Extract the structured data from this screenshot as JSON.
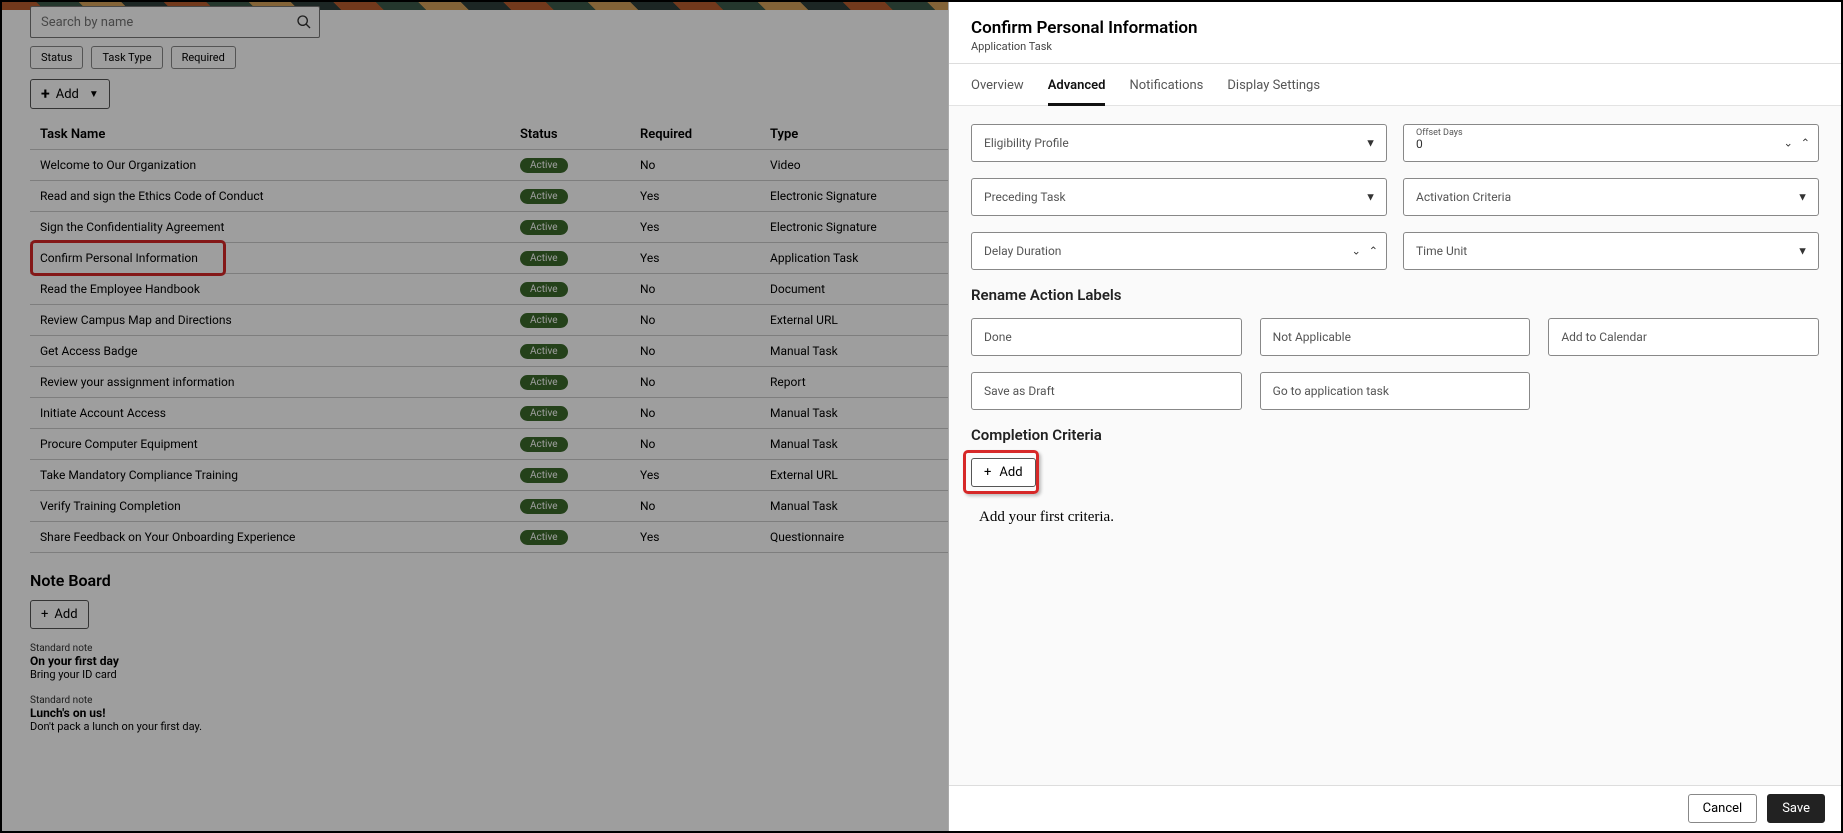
{
  "search": {
    "placeholder": "Search by name"
  },
  "filters": {
    "status": "Status",
    "taskType": "Task Type",
    "required": "Required"
  },
  "toolbar": {
    "add": "Add"
  },
  "table": {
    "headers": {
      "name": "Task Name",
      "status": "Status",
      "required": "Required",
      "type": "Type"
    },
    "rows": [
      {
        "name": "Welcome to Our Organization",
        "status": "Active",
        "required": "No",
        "type": "Video"
      },
      {
        "name": "Read and sign the Ethics Code of Conduct",
        "status": "Active",
        "required": "Yes",
        "type": "Electronic Signature"
      },
      {
        "name": "Sign the Confidentiality Agreement",
        "status": "Active",
        "required": "Yes",
        "type": "Electronic Signature"
      },
      {
        "name": "Confirm Personal Information",
        "status": "Active",
        "required": "Yes",
        "type": "Application Task"
      },
      {
        "name": "Read the Employee Handbook",
        "status": "Active",
        "required": "No",
        "type": "Document"
      },
      {
        "name": "Review Campus Map and Directions",
        "status": "Active",
        "required": "No",
        "type": "External URL"
      },
      {
        "name": "Get Access Badge",
        "status": "Active",
        "required": "No",
        "type": "Manual Task"
      },
      {
        "name": "Review your assignment information",
        "status": "Active",
        "required": "No",
        "type": "Report"
      },
      {
        "name": "Initiate Account Access",
        "status": "Active",
        "required": "No",
        "type": "Manual Task"
      },
      {
        "name": "Procure Computer Equipment",
        "status": "Active",
        "required": "No",
        "type": "Manual Task"
      },
      {
        "name": "Take Mandatory Compliance Training",
        "status": "Active",
        "required": "Yes",
        "type": "External URL"
      },
      {
        "name": "Verify Training Completion",
        "status": "Active",
        "required": "No",
        "type": "Manual Task"
      },
      {
        "name": "Share Feedback on Your Onboarding Experience",
        "status": "Active",
        "required": "Yes",
        "type": "Questionnaire"
      }
    ]
  },
  "noteBoard": {
    "heading": "Note Board",
    "add": "Add",
    "notes": [
      {
        "kind": "Standard note",
        "title": "On your first day",
        "desc": "Bring your ID card"
      },
      {
        "kind": "Standard note",
        "title": "Lunch's on us!",
        "desc": "Don't pack a lunch on your first day."
      }
    ]
  },
  "panel": {
    "title": "Confirm Personal Information",
    "subtitle": "Application Task",
    "tabs": {
      "overview": "Overview",
      "advanced": "Advanced",
      "notifications": "Notifications",
      "display": "Display Settings"
    },
    "fields": {
      "eligibility": "Eligibility Profile",
      "offsetLabel": "Offset Days",
      "offsetValue": "0",
      "preceding": "Preceding Task",
      "activation": "Activation Criteria",
      "delay": "Delay Duration",
      "timeUnit": "Time Unit"
    },
    "rename": {
      "heading": "Rename Action Labels",
      "done": "Done",
      "na": "Not Applicable",
      "addCal": "Add to Calendar",
      "draft": "Save as Draft",
      "goto": "Go to application task"
    },
    "completion": {
      "heading": "Completion Criteria",
      "add": "Add",
      "empty": "Add your first criteria."
    },
    "footer": {
      "cancel": "Cancel",
      "save": "Save"
    }
  }
}
